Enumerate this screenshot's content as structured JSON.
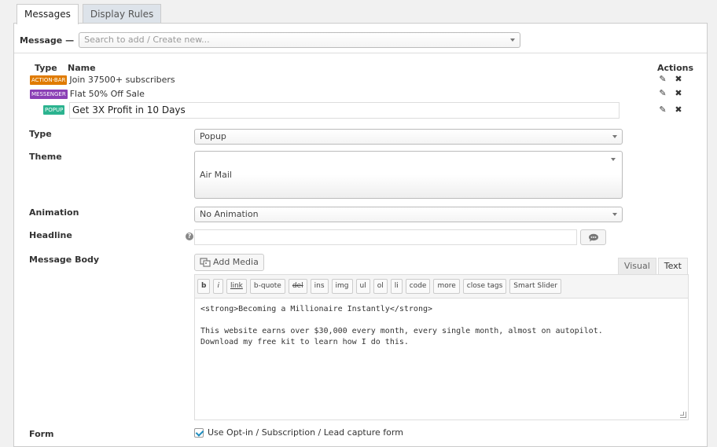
{
  "tabs": [
    {
      "label": "Messages",
      "active": true
    },
    {
      "label": "Display Rules",
      "active": false
    }
  ],
  "message_select": {
    "label": "Message —",
    "placeholder": "Search to add / Create new..."
  },
  "list": {
    "col_type": "Type",
    "col_name": "Name",
    "col_actions": "Actions",
    "items": [
      {
        "badge": "ACTION-BAR",
        "badge_color": "#e07b00",
        "name": "Join 37500+ subscribers"
      },
      {
        "badge": "MESSENGER",
        "badge_color": "#8a3fb5",
        "name": "Flat 50% Off Sale"
      },
      {
        "badge": "POPUP",
        "badge_color": "#2bb38f",
        "name": "Get 3X Profit in 10 Days"
      }
    ],
    "edit_icon": "pencil-icon",
    "delete_icon": "close-icon"
  },
  "form": {
    "type_label": "Type",
    "type_value": "Popup",
    "theme_label": "Theme",
    "theme_value": "Air Mail",
    "animation_label": "Animation",
    "animation_value": "No Animation",
    "headline_label": "Headline",
    "headline_value": "",
    "body_label": "Message Body",
    "add_media": "Add Media",
    "editor_tabs": [
      "Visual",
      "Text"
    ],
    "quicktags": [
      "b",
      "i",
      "link",
      "b-quote",
      "del",
      "ins",
      "img",
      "ul",
      "ol",
      "li",
      "code",
      "more",
      "close tags",
      "Smart Slider"
    ],
    "body_lines": [
      "<strong>Becoming a Millionaire Instantly</strong>",
      "",
      "This website earns over $30,000 every month, every single month, almost on autopilot.",
      "Download my free kit to learn how I do this."
    ],
    "form_label": "Form",
    "form_checkbox": "Use Opt-in / Subscription / Lead capture form",
    "form_checked": true
  }
}
